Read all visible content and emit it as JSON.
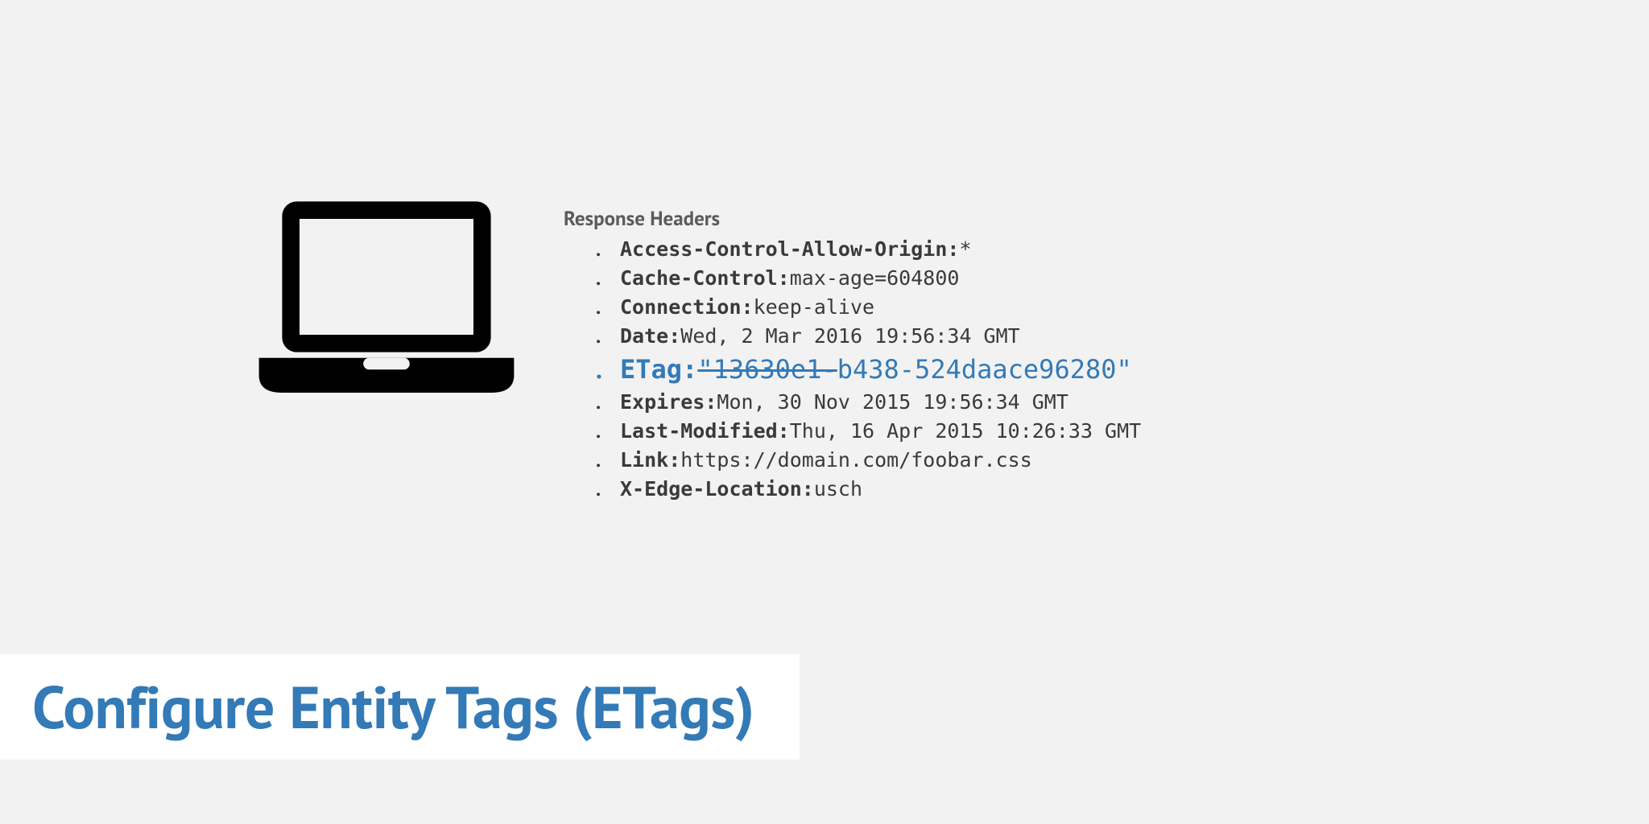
{
  "section_title": "Response Headers",
  "headers": [
    {
      "name": "Access-Control-Allow-Origin:",
      "value": "*",
      "highlight": false,
      "strike": ""
    },
    {
      "name": "Cache-Control:",
      "value": "max-age=604800",
      "highlight": false,
      "strike": ""
    },
    {
      "name": "Connection:",
      "value": "keep-alive",
      "highlight": false,
      "strike": ""
    },
    {
      "name": "Date:",
      "value": "Wed, 2 Mar 2016 19:56:34 GMT",
      "highlight": false,
      "strike": ""
    },
    {
      "name": "ETag:",
      "value": "b438-524daace96280\"",
      "highlight": true,
      "strike": "\"13630e1-"
    },
    {
      "name": "Expires:",
      "value": "Mon, 30 Nov 2015 19:56:34 GMT",
      "highlight": false,
      "strike": ""
    },
    {
      "name": "Last-Modified:",
      "value": "Thu, 16 Apr 2015 10:26:33 GMT",
      "highlight": false,
      "strike": ""
    },
    {
      "name": "Link:",
      "value": "https://domain.com/foobar.css",
      "highlight": false,
      "strike": ""
    },
    {
      "name": "X-Edge-Location:",
      "value": "usch",
      "highlight": false,
      "strike": ""
    }
  ],
  "page_title": "Configure Entity Tags (ETags)"
}
